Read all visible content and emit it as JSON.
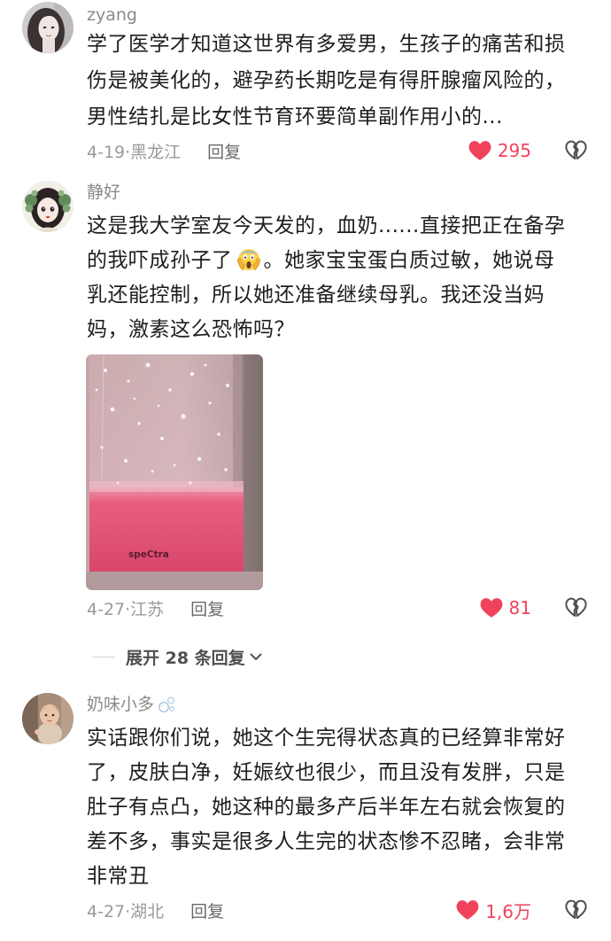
{
  "colors": {
    "like": "#f0435b",
    "text": "#1e1e1e",
    "secondary": "#9a9a9a"
  },
  "icons": {
    "like": "heart-filled-icon",
    "dislike": "broken-heart-icon",
    "expand": "chevron-down-icon"
  },
  "comments": [
    {
      "username": "zyang",
      "avatar": "avatar-photo",
      "lines": [
        "学了医学才知道这世界有多爱男，生孩子的痛苦和损",
        "伤是被美化的，避孕药长期吃是有得肝腺瘤风险的，",
        "男性结扎是比女性节育环要简单副作用小的..."
      ],
      "meta": "4-19·黑龙江",
      "reply_label": "回复",
      "like_count": "295",
      "liked": true
    },
    {
      "username": "静好",
      "avatar": "avatar-cartoon",
      "lines": [
        "这是我大学室友今天发的，血奶......直接把正在备孕",
        {
          "before": "的我吓成孙子了",
          "emoji": "scream-emoji",
          "after": "。她家宝宝蛋白质过敏，她说母"
        },
        "乳还能控制，所以她还准备继续母乳。我还没当妈",
        "妈，激素这么恐怖吗？"
      ],
      "image": {
        "icon": "milk-bottle-photo",
        "logo_text": "speCtra"
      },
      "meta": "4-27·江苏",
      "reply_label": "回复",
      "like_count": "81",
      "liked": true
    },
    {
      "username": "奶味小多",
      "username_icon": "bubbles-icon",
      "avatar": "avatar-baby-photo",
      "lines": [
        "实话跟你们说，她这个生完得状态真的已经算非常好",
        "了，皮肤白净，妊娠纹也很少，而且没有发胖，只是",
        "肚子有点凸，她这种的最多产后半年左右就会恢复的",
        "差不多，事实是很多人生完的状态惨不忍睹，会非常",
        "非常丑"
      ],
      "meta": "4-27·湖北",
      "reply_label": "回复",
      "like_count": "1,6万",
      "liked": true
    }
  ],
  "expand_replies": {
    "label": "展开 28 条回复"
  }
}
